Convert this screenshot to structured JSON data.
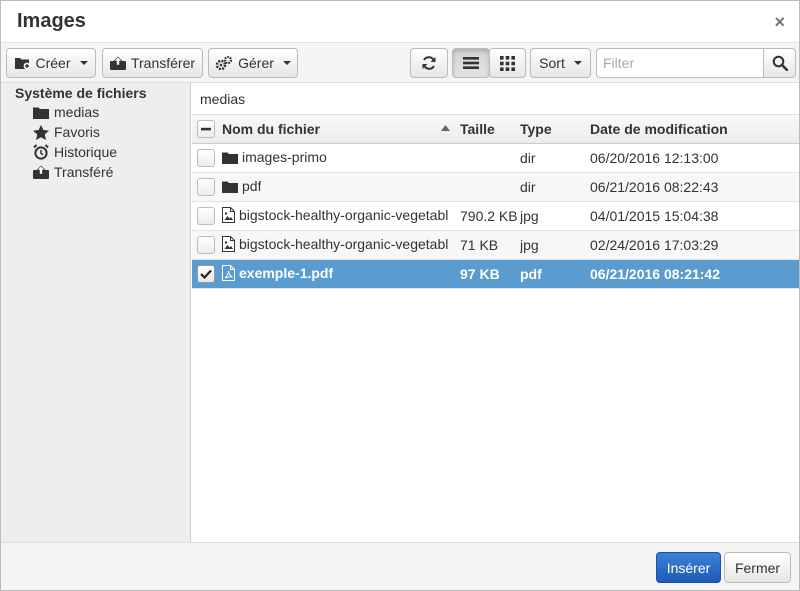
{
  "dialog": {
    "title": "Images",
    "close_symbol": "×"
  },
  "toolbar": {
    "create_label": "Créer",
    "upload_label": "Transférer",
    "manage_label": "Gérer",
    "sort_label": "Sort",
    "filter_placeholder": "Filter",
    "active_view": "list"
  },
  "sidebar": {
    "root_label": "Système de fichiers",
    "items": [
      {
        "label": "medias",
        "icon": "folder-icon"
      },
      {
        "label": "Favoris",
        "icon": "star-icon"
      },
      {
        "label": "Historique",
        "icon": "alarm-clock-icon"
      },
      {
        "label": "Transféré",
        "icon": "upload-box-icon"
      }
    ]
  },
  "main": {
    "current_path": "medias",
    "columns": {
      "name": "Nom du fichier",
      "size": "Taille",
      "type": "Type",
      "date": "Date de modification"
    },
    "rows": [
      {
        "name": "images-primo",
        "size": "",
        "type": "dir",
        "date": "06/20/2016 12:13:00",
        "icon": "folder-icon",
        "checked": false,
        "selected": false
      },
      {
        "name": "pdf",
        "size": "",
        "type": "dir",
        "date": "06/21/2016 08:22:43",
        "icon": "folder-icon",
        "checked": false,
        "selected": false
      },
      {
        "name": "bigstock-healthy-organic-vegetabl",
        "size": "790.2 KB",
        "type": "jpg",
        "date": "04/01/2015 15:04:38",
        "icon": "image-file-icon",
        "checked": false,
        "selected": false
      },
      {
        "name": "bigstock-healthy-organic-vegetabl",
        "size": "71 KB",
        "type": "jpg",
        "date": "02/24/2016 17:03:29",
        "icon": "image-file-icon",
        "checked": false,
        "selected": false
      },
      {
        "name": "exemple-1.pdf",
        "size": "97 KB",
        "type": "pdf",
        "date": "06/21/2016 08:21:42",
        "icon": "pdf-file-icon",
        "checked": true,
        "selected": true
      }
    ]
  },
  "footer": {
    "insert_label": "Insérer",
    "close_label": "Fermer"
  },
  "colors": {
    "selection": "#5a9ccf",
    "primary_button": "#2a6acb"
  }
}
